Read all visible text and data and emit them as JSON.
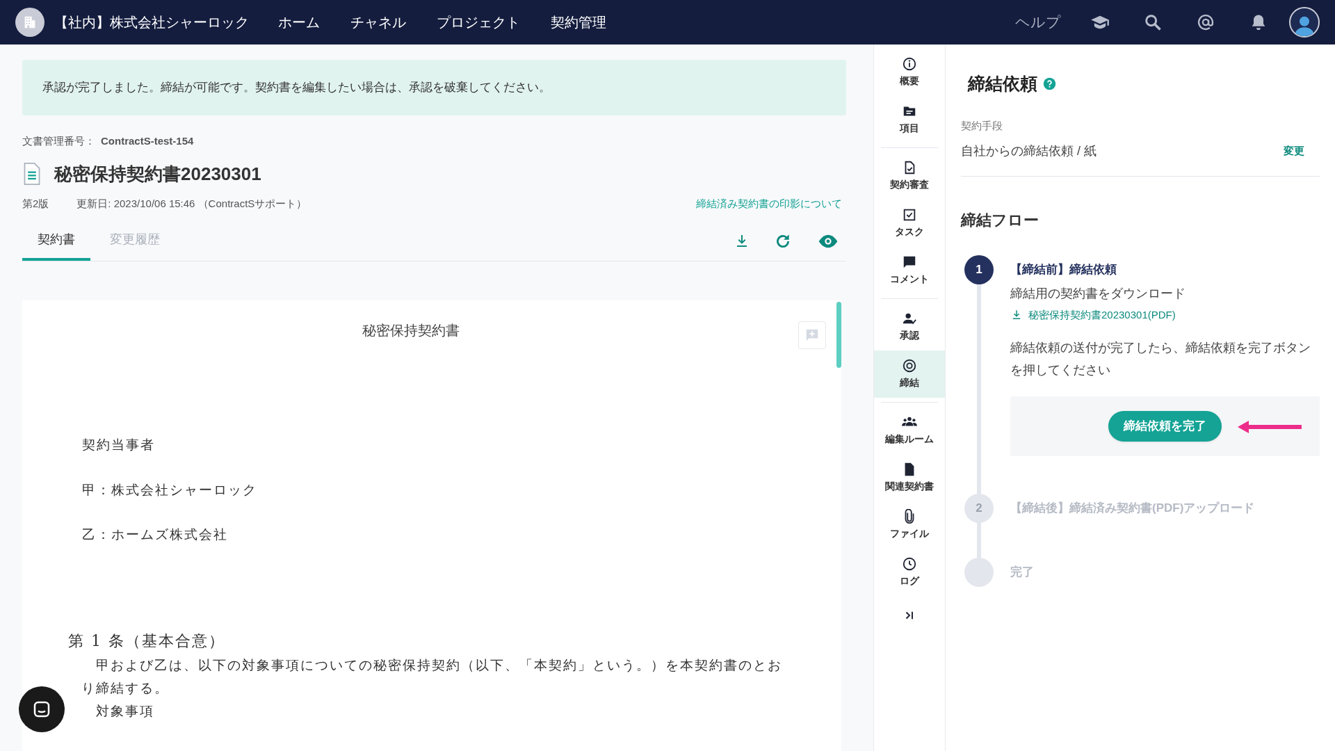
{
  "top_bar": {
    "org": "【社内】株式会社シャーロック",
    "nav": [
      "ホーム",
      "チャネル",
      "プロジェクト",
      "契約管理"
    ],
    "help": "ヘルプ"
  },
  "banner": "承認が完了しました。締結が可能です。契約書を編集したい場合は、承認を破棄してください。",
  "document": {
    "number_label": "文書管理番号：",
    "number": "ContractS-test-154",
    "title": "秘密保持契約書20230301",
    "version": "第2版",
    "updated": "更新日: 2023/10/06 15:46 （ContractSサポート）",
    "stamp_link": "締結済み契約書の印影について"
  },
  "tabs": [
    {
      "label": "契約書",
      "selected": true
    },
    {
      "label": "変更履歴",
      "selected": false
    }
  ],
  "paper": {
    "heading": "秘密保持契約書",
    "blocks": [
      {
        "kind": "party",
        "text": "契約当事者"
      },
      {
        "kind": "party",
        "text": "甲：株式会社シャーロック"
      },
      {
        "kind": "party",
        "text": "乙：ホームズ株式会社"
      },
      {
        "kind": "article",
        "text": "第 1 条（基本合意）"
      },
      {
        "kind": "body",
        "text": "甲および乙は、以下の対象事項についての秘密保持契約（以下、「本契約」という。）を本契約書のとおり締結する。"
      },
      {
        "kind": "body",
        "text": "対象事項"
      }
    ]
  },
  "side_nav": [
    {
      "items": [
        {
          "label": "概要",
          "kind": "info",
          "selected": false
        },
        {
          "label": "項目",
          "kind": "folder",
          "selected": false
        }
      ]
    },
    {
      "items": [
        {
          "label": "契約審査",
          "kind": "review",
          "selected": false
        },
        {
          "label": "タスク",
          "kind": "task",
          "selected": false
        },
        {
          "label": "コメント",
          "kind": "comment",
          "selected": false
        }
      ]
    },
    {
      "items": [
        {
          "label": "承認",
          "kind": "approval",
          "selected": false
        },
        {
          "label": "締結",
          "kind": "signing",
          "selected": true
        }
      ]
    },
    {
      "items": [
        {
          "label": "編集ルーム",
          "kind": "room",
          "selected": false
        },
        {
          "label": "関連契約書",
          "kind": "related",
          "selected": false
        },
        {
          "label": "ファイル",
          "kind": "files",
          "selected": false
        },
        {
          "label": "ログ",
          "kind": "log",
          "selected": false
        }
      ]
    }
  ],
  "panel": {
    "title": "締結依頼",
    "method_label": "契約手段",
    "method_value": "自社からの締結依頼 / 紙",
    "change": "変更",
    "flow_title": "締結フロー",
    "steps": [
      {
        "number": "1",
        "title": "【締結前】締結依頼",
        "active": true,
        "description": "締結用の契約書をダウンロード",
        "download": "秘密保持契約書20230301(PDF)",
        "instruction": "締結依頼の送付が完了したら、締結依頼を完了ボタンを押してください",
        "button": "締結依頼を完了"
      },
      {
        "number": "2",
        "title": "【締結後】締結済み契約書(PDF)アップロード",
        "active": false
      },
      {
        "title": "完了",
        "active": false
      }
    ]
  }
}
